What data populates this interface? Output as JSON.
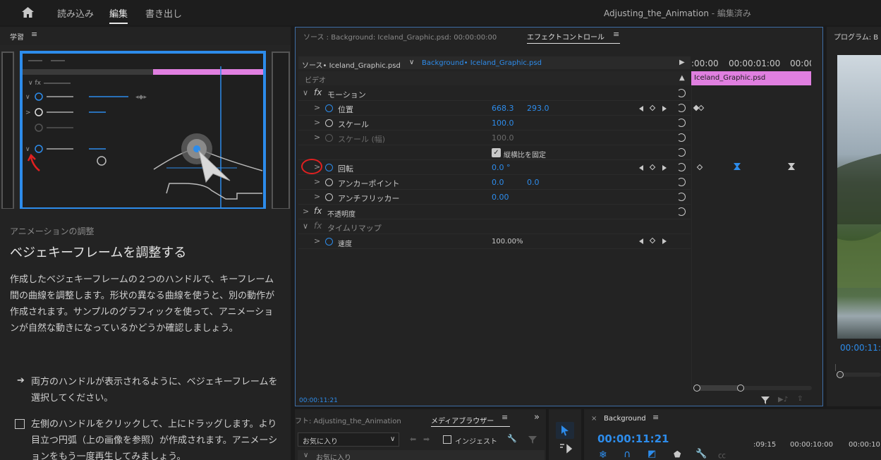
{
  "topbar": {
    "home_icon": "home-icon",
    "tabs": [
      "読み込み",
      "編集",
      "書き出し"
    ],
    "title": "Adjusting_the_Animation",
    "title_suffix": " - 編集済み"
  },
  "learn": {
    "panel_title": "学習",
    "category": "アニメーションの調整",
    "heading": "ベジェキーフレームを調整する",
    "body": "作成したベジェキーフレームの２つのハンドルで、キーフレーム間の曲線を調整します。形状の異なる曲線を使うと、別の動作が作成されます。サンプルのグラフィックを使って、アニメーションが自然な動きになっているかどうか確認しましょう。",
    "step1": "両方のハンドルが表示されるように、ベジェキーフレームを選択してください。",
    "step2": "左側のハンドルをクリックして、上にドラッグします。より目立つ円弧（上の画像を参照）が作成されます。アニメーションをもう一度再生してみましょう。"
  },
  "effect": {
    "source_tab": "ソース : Background: Iceland_Graphic.psd: 00:00:00:00",
    "active_tab": "エフェクトコントロール",
    "source_clip": "ソース• Iceland_Graphic.psd",
    "target_clip": "Background• Iceland_Graphic.psd",
    "ruler": [
      ":00:00",
      "00:00:01:00",
      "00:00"
    ],
    "clip_label": "Iceland_Graphic.psd",
    "video_label": "ビデオ",
    "motion_label": "モーション",
    "position_label": "位置",
    "position_x": "668.3",
    "position_y": "293.0",
    "scale_label": "スケール",
    "scale_value": "100.0",
    "scale_width_label": "スケール (幅)",
    "scale_width_value": "100.0",
    "uniform_label": "縦横比を固定",
    "rotation_label": "回転",
    "rotation_value": "0.0 °",
    "anchor_label": "アンカーポイント",
    "anchor_x": "0.0",
    "anchor_y": "0.0",
    "antiflicker_label": "アンチフリッカー",
    "antiflicker_value": "0.00",
    "opacity_label": "不透明度",
    "timeremap_label": "タイムリマップ",
    "speed_label": "速度",
    "speed_value": "100.00%",
    "timecode": "00:00:11:21"
  },
  "program": {
    "title": "プログラム: B",
    "timecode": "00:00:11:"
  },
  "project": {
    "tab1": "フト: Adjusting_the_Animation",
    "tab2": "メディアブラウザー",
    "dropdown": "お気に入り",
    "ingest": "インジェスト",
    "tree_item": "お気に入り"
  },
  "timeline": {
    "sequence": "Background",
    "timecode": "00:00:11:21",
    "ruler": [
      ":09:15",
      "00:00:10:00",
      "00:00:10"
    ]
  },
  "colors": {
    "accent": "#2d8ceb",
    "clip": "#e07fe0",
    "panel_border": "#3e6ea6",
    "annotation": "#e02020"
  }
}
